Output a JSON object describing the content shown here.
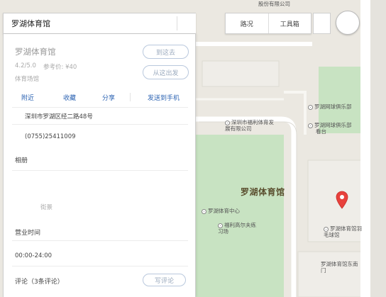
{
  "search": {
    "value": "罗湖体育馆",
    "placeholder": ""
  },
  "toolbar": {
    "traffic_label": "路况",
    "toolbox_label": "工具箱"
  },
  "place": {
    "name": "罗湖体育馆",
    "rating": "4.2/5.0",
    "price": "参考价: ¥40",
    "category": "体育场馆",
    "go_there_label": "到这去",
    "from_here_label": "从这出发",
    "actions": {
      "nearby": "附近",
      "favorite": "收藏",
      "share": "分享",
      "send_to_phone": "发送到手机"
    },
    "address": "深圳市罗湖区经二路48号",
    "phone": "(0755)25411009",
    "photos_title": "相册",
    "streetview_label": "街景",
    "hours_title": "营业时间",
    "hours": "00:00-24:00",
    "reviews_title": "评论（3条评论）",
    "write_review_label": "写评论"
  },
  "map": {
    "labels": {
      "top_fragment": "股份有限公司",
      "luohu_tennis_club": "罗湖网球俱乐部",
      "luohu_tennis_stand": "罗湖网球俱乐部",
      "tennis_stand_suffix": "看台",
      "fuli_company": "深圳市福利体育发展有限公司",
      "venue": "罗湖体育馆",
      "sports_center": "罗湖体育中心",
      "golf_range": "福利高尔夫练习场",
      "badminton_hall": "罗湖体育馆羽毛球馆",
      "east_gate": "罗湖体育馆东南门"
    },
    "colors": {
      "green": "#c8e3c2",
      "road": "#ffffff",
      "land": "#ebe8e1",
      "pin": "#e8413c"
    }
  }
}
